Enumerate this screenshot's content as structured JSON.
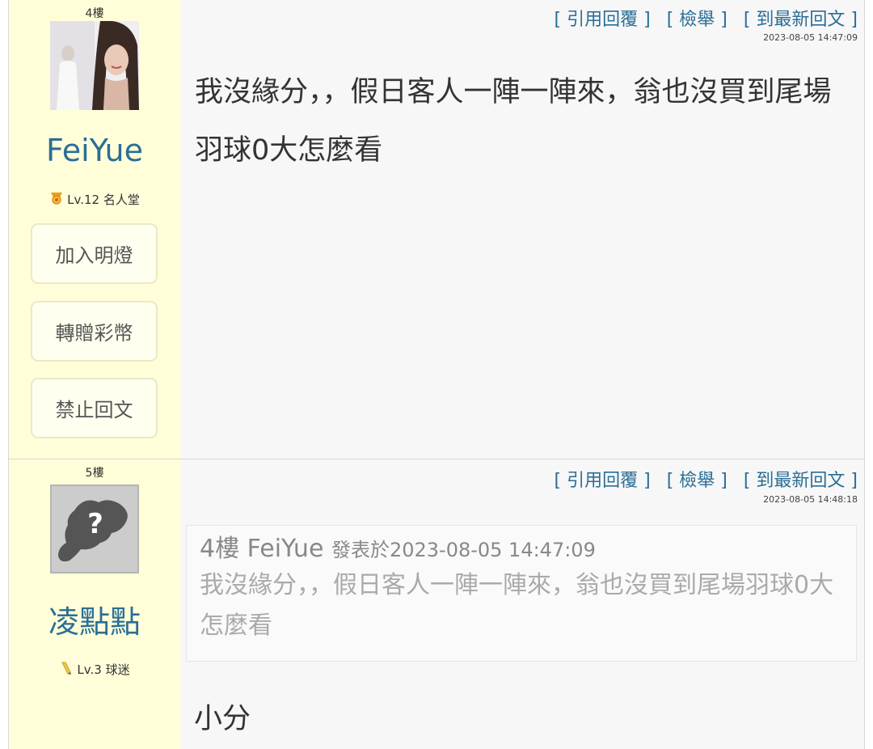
{
  "actions": {
    "quote_reply": "[ 引用回覆 ]",
    "report": "[ 檢舉 ]",
    "to_latest": "[ 到最新回文 ]"
  },
  "posts": [
    {
      "floor": "4樓",
      "username": "FeiYue",
      "level": "Lv.12 名人堂",
      "level_icon": "medal-icon",
      "timestamp": "2023-08-05 14:47:09",
      "content": "我沒緣分，，假日客人一陣一陣來，翁也沒買到尾場羽球0大怎麼看",
      "buttons": {
        "light": "加入明燈",
        "gift": "轉贈彩幣",
        "ban": "禁止回文"
      }
    },
    {
      "floor": "5樓",
      "username": "凌點點",
      "level": "Lv.3 球迷",
      "level_icon": "pencil-icon",
      "timestamp": "2023-08-05 14:48:18",
      "quote": {
        "floor": "4樓",
        "author": "FeiYue",
        "posted_label": "發表於",
        "posted_time": "2023-08-05 14:47:09",
        "text": "我沒緣分，，假日客人一陣一陣來，翁也沒買到尾場羽球0大怎麼看"
      },
      "content": "小分"
    }
  ]
}
